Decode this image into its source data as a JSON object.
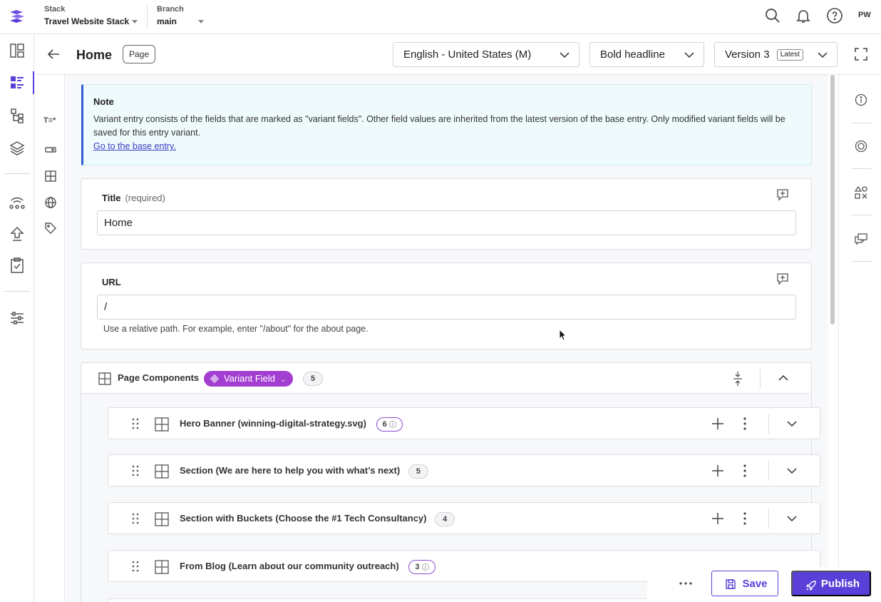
{
  "topbar": {
    "stack_label": "Stack",
    "stack_value": "Travel Website Stack",
    "branch_label": "Branch",
    "branch_value": "main",
    "user_initials": "PW"
  },
  "header": {
    "title": "Home",
    "content_type": "Page",
    "locale": "English - United States (M)",
    "variant": "Bold headline",
    "version": "Version 3",
    "version_tag": "Latest"
  },
  "note": {
    "heading": "Note",
    "body": "Variant entry consists of the fields that are marked as \"variant fields\". Other field values are inherited from the latest version of the base entry. Only modified variant fields will be saved for this entry variant.",
    "link": "Go to the base entry."
  },
  "fields": {
    "title_label": "Title",
    "title_hint": "(required)",
    "title_value": "Home",
    "url_label": "URL",
    "url_value": "/",
    "url_help": "Use a relative path. For example, enter \"/about\" for the about page."
  },
  "components": {
    "label": "Page Components",
    "variant_label": "Variant Field",
    "count": "5",
    "items": [
      {
        "title": "Hero Banner (winning-digital-strategy.svg)",
        "count": "6",
        "info": true
      },
      {
        "title": "Section (We are here to help you with what’s next)",
        "count": "5",
        "info": false
      },
      {
        "title": "Section with Buckets (Choose the #1 Tech Consultancy)",
        "count": "4",
        "info": false
      },
      {
        "title": "From Blog (Learn about our community outreach)",
        "count": "3",
        "info": true
      }
    ]
  },
  "actions": {
    "save": "Save",
    "publish": "Publish"
  },
  "colors": {
    "brand": "#5b3fd9",
    "variant": "#a23fd1",
    "note_bg": "#effafc"
  }
}
